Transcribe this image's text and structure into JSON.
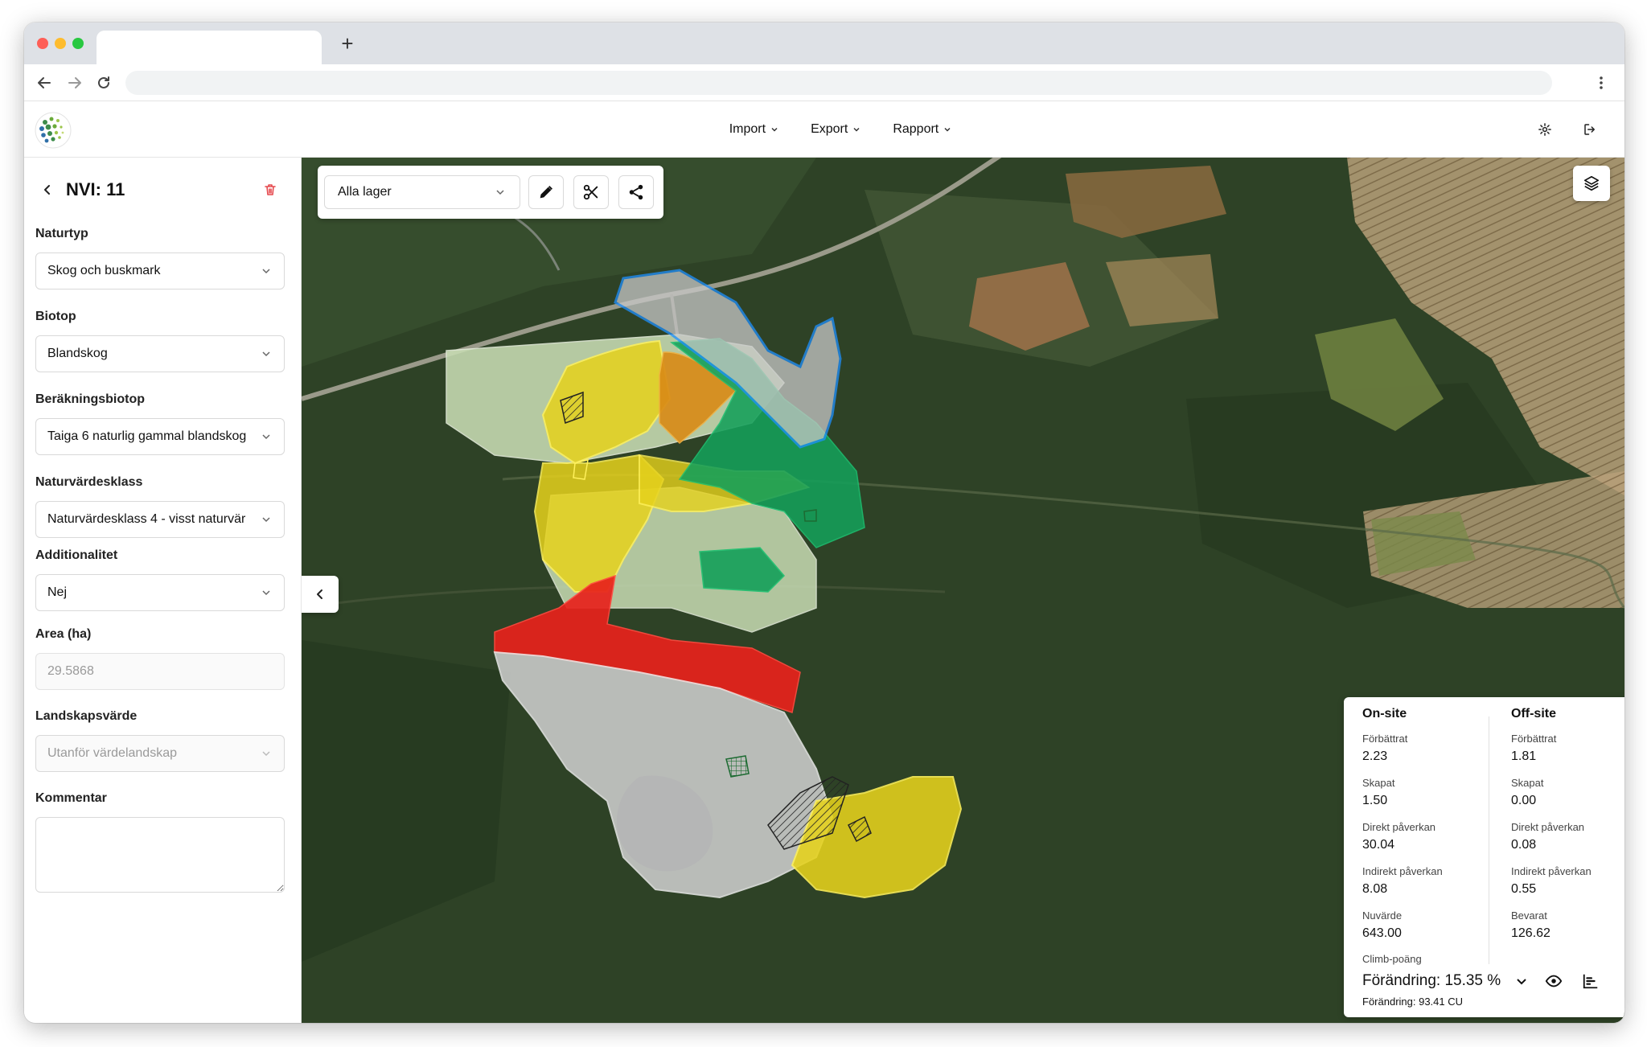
{
  "header": {
    "menus": [
      {
        "label": "Import"
      },
      {
        "label": "Export"
      },
      {
        "label": "Rapport"
      }
    ]
  },
  "sidebar": {
    "title": "NVI: 11",
    "fields": {
      "naturtyp": {
        "label": "Naturtyp",
        "value": "Skog och buskmark"
      },
      "biotop": {
        "label": "Biotop",
        "value": "Blandskog"
      },
      "berakningsbiotop": {
        "label": "Beräkningsbiotop",
        "value": "Taiga 6 naturlig gammal blandskog"
      },
      "naturvardesklass": {
        "label": "Naturvärdesklass",
        "value": "Naturvärdesklass 4 - visst naturvär"
      },
      "additionalitet": {
        "label": "Additionalitet",
        "value": "Nej"
      },
      "area": {
        "label": "Area (ha)",
        "value": "29.5868"
      },
      "landskapsvarde": {
        "label": "Landskapsvärde",
        "value": "Utanför värdelandskap"
      },
      "kommentar": {
        "label": "Kommentar",
        "value": ""
      }
    }
  },
  "map": {
    "layer_select": "Alla lager"
  },
  "stats": {
    "onsite": {
      "title": "On-site",
      "forbattrat": {
        "label": "Förbättrat",
        "value": "2.23"
      },
      "skapat": {
        "label": "Skapat",
        "value": "1.50"
      },
      "direkt": {
        "label": "Direkt påverkan",
        "value": "30.04"
      },
      "indirekt": {
        "label": "Indirekt påverkan",
        "value": "8.08"
      },
      "nuvarde": {
        "label": "Nuvärde",
        "value": "643.00"
      }
    },
    "offsite": {
      "title": "Off-site",
      "forbattrat": {
        "label": "Förbättrat",
        "value": "1.81"
      },
      "skapat": {
        "label": "Skapat",
        "value": "0.00"
      },
      "direkt": {
        "label": "Direkt påverkan",
        "value": "0.08"
      },
      "indirekt": {
        "label": "Indirekt påverkan",
        "value": "0.55"
      },
      "bevarat": {
        "label": "Bevarat",
        "value": "126.62"
      }
    },
    "climb": {
      "label": "Climb-poäng",
      "change": "Förändring: 15.35 %",
      "change_cu": "Förändring: 93.41 CU"
    }
  },
  "colors": {
    "forest": "#2e4226",
    "yellow_zone": "#e6d21c",
    "green_zone": "#14a05a",
    "red_zone": "#e8221c",
    "orange_zone": "#d98a16",
    "light_green_zone": "#c8dcb4",
    "grey_zone": "#d2d2d2",
    "blue_outline": "#1e90ff",
    "delete_red": "#e5484d"
  }
}
